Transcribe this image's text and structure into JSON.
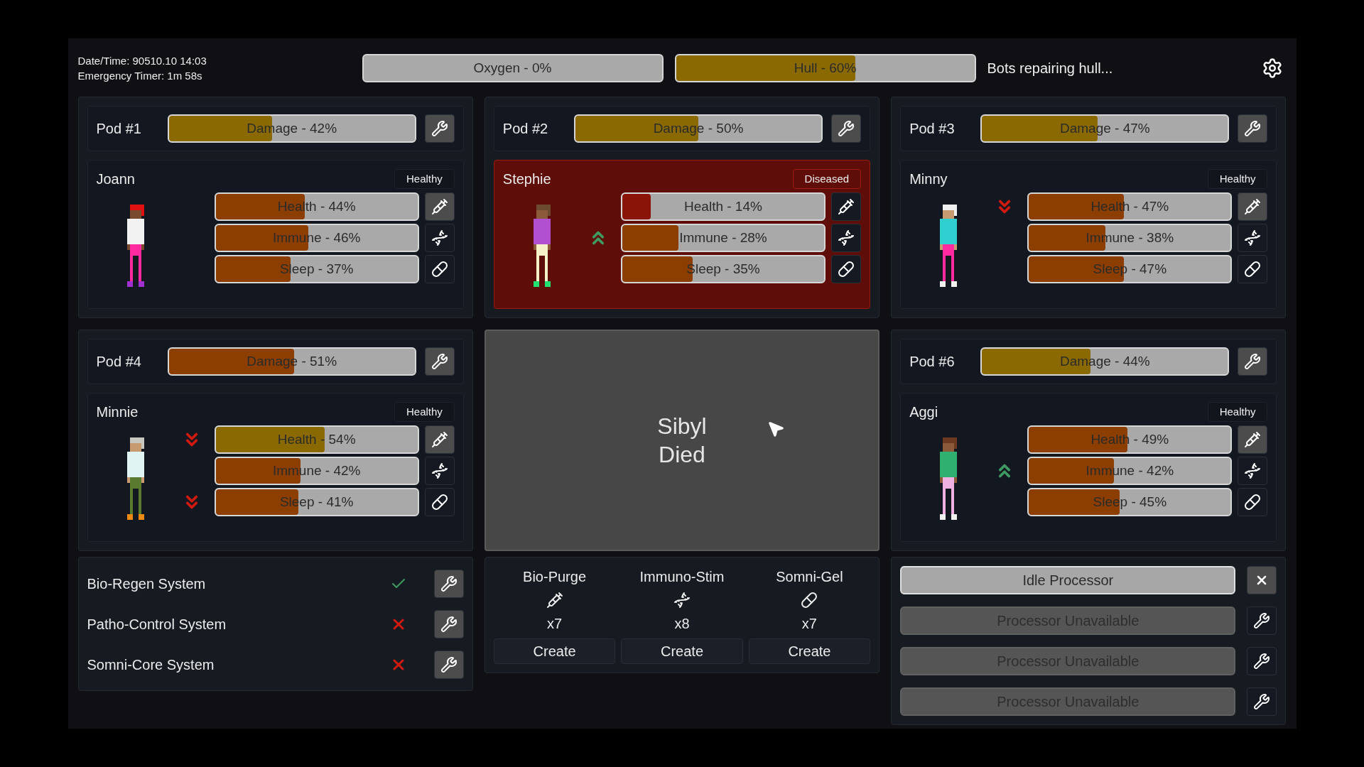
{
  "header": {
    "info_lines": [
      "Date/Time: 90510.10 14:03",
      "Emergency Timer: 1m 58s"
    ],
    "meters": [
      {
        "label": "Oxygen - 0%",
        "level": 0
      },
      {
        "label": "Hull - 60%",
        "level": 0.6,
        "color": "#8a6a00"
      }
    ],
    "status": "Bots repairing hull..."
  },
  "pods": [
    {
      "kind": "occupied",
      "label": "Pod #1",
      "damage": {
        "label": "Damage - 42%",
        "level": 0.42,
        "color": "#8a6a00"
      },
      "occupant": {
        "name": "Joann",
        "status": "Healthy",
        "diseased": false,
        "figure": [
          {
            "kind": "hair",
            "color": "#e01010"
          },
          {
            "kind": "skin",
            "color": "#7a4a2e"
          },
          {
            "kind": "shirt",
            "color": "#f2f2f2"
          },
          {
            "kind": "pants",
            "color": "#ff2aa0"
          },
          {
            "kind": "shoes",
            "color": "#a030d0"
          }
        ],
        "stats": [
          {
            "kind": "health",
            "label": "Health - 44%",
            "level": 0.44,
            "color": "#8c3d00",
            "active": true,
            "rising": false,
            "falling": false
          },
          {
            "kind": "immune",
            "label": "Immune - 46%",
            "level": 0.46,
            "color": "#8c3d00",
            "active": false,
            "rising": false,
            "falling": false
          },
          {
            "kind": "sleep",
            "label": "Sleep - 37%",
            "level": 0.37,
            "color": "#8c3d00",
            "active": false,
            "rising": false,
            "falling": false
          }
        ]
      }
    },
    {
      "kind": "occupied",
      "label": "Pod #2",
      "damage": {
        "label": "Damage - 50%",
        "level": 0.5,
        "color": "#8a6a00"
      },
      "occupant": {
        "name": "Stephie",
        "status": "Diseased",
        "diseased": true,
        "figure": [
          {
            "kind": "hair",
            "color": "#6b4a30"
          },
          {
            "kind": "skin",
            "color": "#8a5a3a"
          },
          {
            "kind": "shirt",
            "color": "#b050d0"
          },
          {
            "kind": "pants",
            "color": "#f5f0c8"
          },
          {
            "kind": "shoes",
            "color": "#20e070"
          }
        ],
        "stats": [
          {
            "kind": "health",
            "label": "Health - 14%",
            "level": 0.14,
            "color": "#8b1408",
            "active": false,
            "rising": false,
            "falling": false
          },
          {
            "kind": "immune",
            "label": "Immune - 28%",
            "level": 0.28,
            "color": "#8c3d00",
            "active": false,
            "rising": true,
            "falling": false
          },
          {
            "kind": "sleep",
            "label": "Sleep - 35%",
            "level": 0.35,
            "color": "#8c3d00",
            "active": false,
            "rising": false,
            "falling": false
          }
        ]
      }
    },
    {
      "kind": "occupied",
      "label": "Pod #3",
      "damage": {
        "label": "Damage - 47%",
        "level": 0.47,
        "color": "#8a6a00"
      },
      "occupant": {
        "name": "Minny",
        "status": "Healthy",
        "diseased": false,
        "figure": [
          {
            "kind": "hair",
            "color": "#f0f0f0"
          },
          {
            "kind": "skin",
            "color": "#c89a70"
          },
          {
            "kind": "shirt",
            "color": "#30d0d0"
          },
          {
            "kind": "pants",
            "color": "#ff2aa0"
          },
          {
            "kind": "shoes",
            "color": "#f0f0f0"
          }
        ],
        "stats": [
          {
            "kind": "health",
            "label": "Health - 47%",
            "level": 0.47,
            "color": "#8c3d00",
            "active": true,
            "rising": false,
            "falling": true
          },
          {
            "kind": "immune",
            "label": "Immune - 38%",
            "level": 0.38,
            "color": "#8c3d00",
            "active": false,
            "rising": false,
            "falling": false
          },
          {
            "kind": "sleep",
            "label": "Sleep - 47%",
            "level": 0.47,
            "color": "#8c3d00",
            "active": false,
            "rising": false,
            "falling": false
          }
        ]
      }
    },
    {
      "kind": "occupied",
      "label": "Pod #4",
      "damage": {
        "label": "Damage - 51%",
        "level": 0.51,
        "color": "#8c3d00"
      },
      "occupant": {
        "name": "Minnie",
        "status": "Healthy",
        "diseased": false,
        "figure": [
          {
            "kind": "hair",
            "color": "#c8c8c0"
          },
          {
            "kind": "skin",
            "color": "#c89a70"
          },
          {
            "kind": "shirt",
            "color": "#e0f4f4"
          },
          {
            "kind": "pants",
            "color": "#5a7a30"
          },
          {
            "kind": "shoes",
            "color": "#f08a10"
          }
        ],
        "stats": [
          {
            "kind": "health",
            "label": "Health - 54%",
            "level": 0.54,
            "color": "#8a6a00",
            "active": true,
            "rising": false,
            "falling": true
          },
          {
            "kind": "immune",
            "label": "Immune - 42%",
            "level": 0.42,
            "color": "#8c3d00",
            "active": false,
            "rising": false,
            "falling": false
          },
          {
            "kind": "sleep",
            "label": "Sleep - 41%",
            "level": 0.41,
            "color": "#8c3d00",
            "active": false,
            "rising": false,
            "falling": true
          }
        ]
      }
    },
    {
      "kind": "dead",
      "message": [
        "Sibyl",
        "Died"
      ]
    },
    {
      "kind": "occupied",
      "label": "Pod #6",
      "damage": {
        "label": "Damage - 44%",
        "level": 0.44,
        "color": "#8a6a00"
      },
      "occupant": {
        "name": "Aggi",
        "status": "Healthy",
        "diseased": false,
        "figure": [
          {
            "kind": "hair",
            "color": "#6b3a20"
          },
          {
            "kind": "skin",
            "color": "#8a5a3a"
          },
          {
            "kind": "shirt",
            "color": "#30b070"
          },
          {
            "kind": "pants",
            "color": "#f0b0e0"
          },
          {
            "kind": "shoes",
            "color": "#f0f0f0"
          }
        ],
        "stats": [
          {
            "kind": "health",
            "label": "Health - 49%",
            "level": 0.49,
            "color": "#8c3d00",
            "active": true,
            "rising": false,
            "falling": false
          },
          {
            "kind": "immune",
            "label": "Immune - 42%",
            "level": 0.42,
            "color": "#8c3d00",
            "active": false,
            "rising": true,
            "falling": false
          },
          {
            "kind": "sleep",
            "label": "Sleep - 45%",
            "level": 0.45,
            "color": "#8c3d00",
            "active": false,
            "rising": false,
            "falling": false
          }
        ]
      }
    }
  ],
  "systems": [
    {
      "name": "Bio-Regen System",
      "ok": true
    },
    {
      "name": "Patho-Control System",
      "ok": false
    },
    {
      "name": "Somni-Core System",
      "ok": false
    }
  ],
  "supplies": [
    {
      "kind": "health",
      "name": "Bio-Purge",
      "count": "x7",
      "button": "Create"
    },
    {
      "kind": "immune",
      "name": "Immuno-Stim",
      "count": "x8",
      "button": "Create"
    },
    {
      "kind": "sleep",
      "name": "Somni-Gel",
      "count": "x7",
      "button": "Create"
    }
  ],
  "processors": [
    {
      "kind": "idle",
      "label": "Idle Processor"
    },
    {
      "kind": "unavailable",
      "label": "Processor Unavailable"
    },
    {
      "kind": "unavailable",
      "label": "Processor Unavailable"
    },
    {
      "kind": "unavailable",
      "label": "Processor Unavailable"
    }
  ]
}
